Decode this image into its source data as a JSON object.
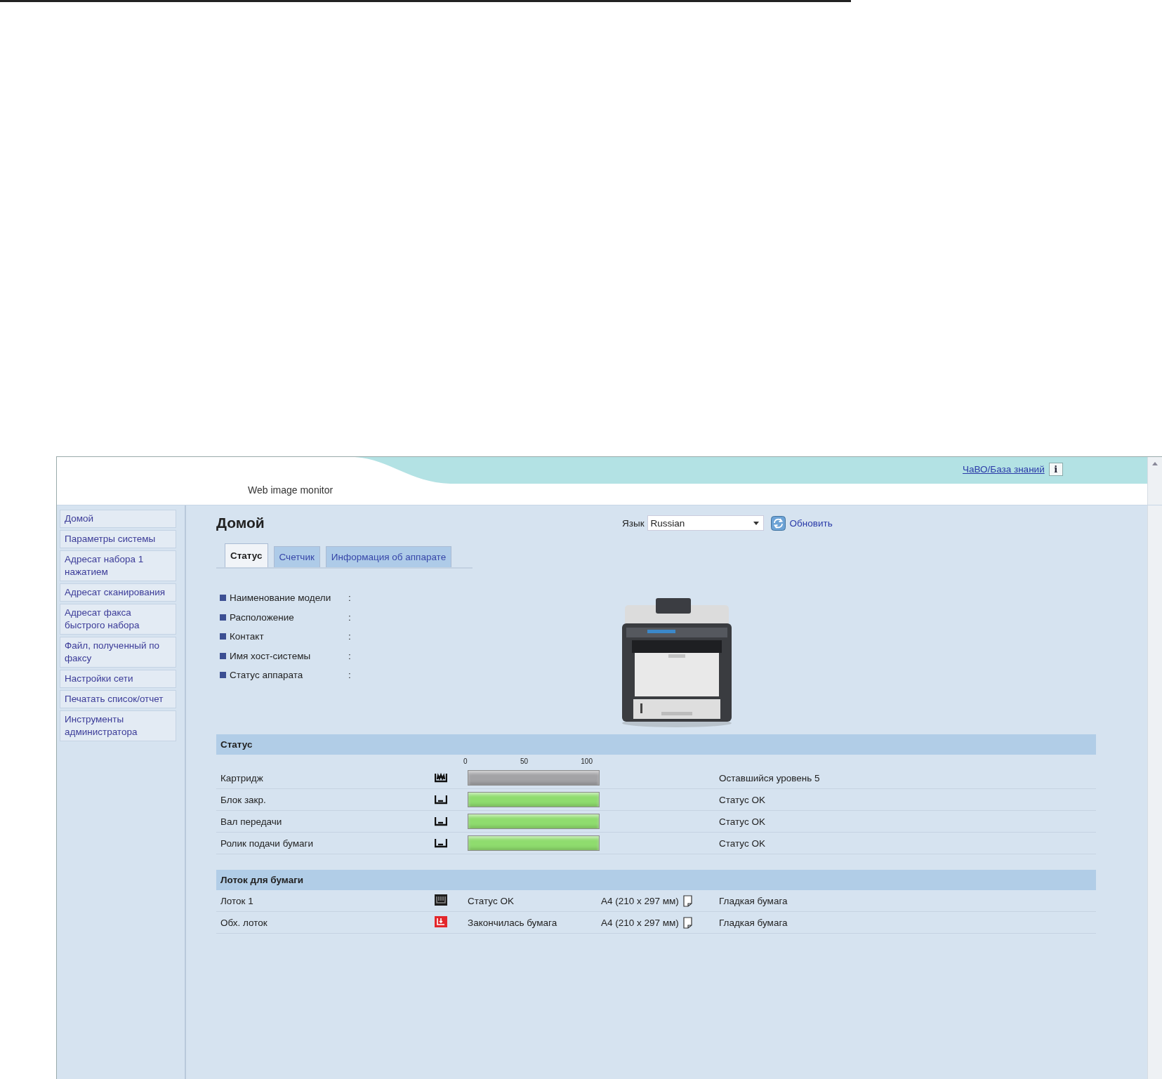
{
  "header": {
    "product": "Web image monitor",
    "help_link": "ЧаВО/База знаний",
    "info_button": "i"
  },
  "sidebar": {
    "items": [
      {
        "label": "Домой"
      },
      {
        "label": "Параметры системы"
      },
      {
        "label": "Адресат набора 1 нажатием"
      },
      {
        "label": "Адресат сканирования"
      },
      {
        "label": "Адресат факса быстрого набора"
      },
      {
        "label": "Файл, полученный по факсу"
      },
      {
        "label": "Настройки сети"
      },
      {
        "label": "Печатать список/отчет"
      },
      {
        "label": "Инструменты администратора"
      }
    ]
  },
  "page": {
    "title": "Домой",
    "language_label": "Язык",
    "language": "Russian",
    "refresh": "Обновить"
  },
  "tabs": [
    {
      "label": "Статус",
      "selected": true
    },
    {
      "label": "Счетчик",
      "selected": false
    },
    {
      "label": "Информация об аппарате",
      "selected": false
    }
  ],
  "device_info": [
    {
      "label": "Наименование модели",
      "separator": ":"
    },
    {
      "label": "Расположение",
      "separator": ":"
    },
    {
      "label": "Контакт",
      "separator": ":"
    },
    {
      "label": "Имя хост-системы",
      "separator": ":"
    },
    {
      "label": "Статус аппарата",
      "separator": ":"
    }
  ],
  "status": {
    "title": "Статус",
    "scale": [
      "0",
      "50",
      "100"
    ],
    "rows": [
      {
        "name": "Картридж",
        "kind": "toner",
        "level": 1,
        "color": "#a3a3a6",
        "reading": "Оставшийся уровень 5"
      },
      {
        "name": "Блок закр.",
        "kind": "unit",
        "level": 1,
        "color": "#8fdc6e",
        "reading": "Статус OK"
      },
      {
        "name": "Вал передачи",
        "kind": "unit",
        "level": 1,
        "color": "#8fdc6e",
        "reading": "Статус OK"
      },
      {
        "name": "Ролик подачи бумаги",
        "kind": "unit",
        "level": 1,
        "color": "#8fdc6e",
        "reading": "Статус OK"
      }
    ]
  },
  "trays": {
    "title": "Лоток для бумаги",
    "rows": [
      {
        "name": "Лоток 1",
        "kind": "ok",
        "status": "Статус OK",
        "size": "A4 (210 x 297 мм)",
        "paper": "Гладкая бумага"
      },
      {
        "name": "Обх. лоток",
        "kind": "empty",
        "status": "Закончилась бумага",
        "size": "A4 (210 x 297 мм)",
        "paper": "Гладкая бумага"
      }
    ]
  }
}
